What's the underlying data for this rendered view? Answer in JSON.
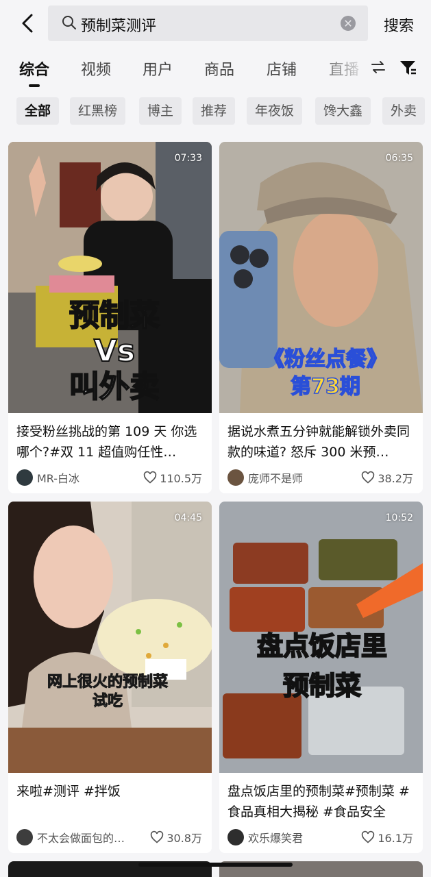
{
  "header": {
    "search_query": "预制菜测评",
    "search_button": "搜索"
  },
  "tabs": [
    "综合",
    "视频",
    "用户",
    "商品",
    "店铺",
    "直播"
  ],
  "chips": [
    "全部",
    "红黑榜",
    "博主",
    "推荐",
    "年夜饭",
    "馋大鑫",
    "外卖"
  ],
  "cards": [
    {
      "duration": "07:33",
      "overlay": [
        "预制菜",
        "Vs",
        "叫外卖"
      ],
      "title": "接受粉丝挑战的第 109 天 你选哪个?#双 11 超值购任性…",
      "author": "MR-白冰",
      "likes": "110.5万"
    },
    {
      "duration": "06:35",
      "overlay": [
        "《粉丝点餐》",
        "第73期"
      ],
      "title": "据说水煮五分钟就能解锁外卖同款的味道? 怒斥 300 米预…",
      "author": "庞师不是师",
      "likes": "38.2万"
    },
    {
      "duration": "04:45",
      "overlay": [
        "网上很火的预制菜",
        "试吃"
      ],
      "title": "来啦#测评 #拌饭",
      "author": "不太会做面包的…",
      "likes": "30.8万"
    },
    {
      "duration": "10:52",
      "overlay": [
        "盘点饭店里",
        "预制菜"
      ],
      "title": "盘点饭店里的预制菜#预制菜 #食品真相大揭秘 #食品安全",
      "author": "欢乐爆笑君",
      "likes": "16.1万"
    }
  ],
  "colors": {
    "accent_text": "#111111",
    "overlay_yellow": "#ffd83a",
    "overlay_blue": "#2a4fd8"
  }
}
